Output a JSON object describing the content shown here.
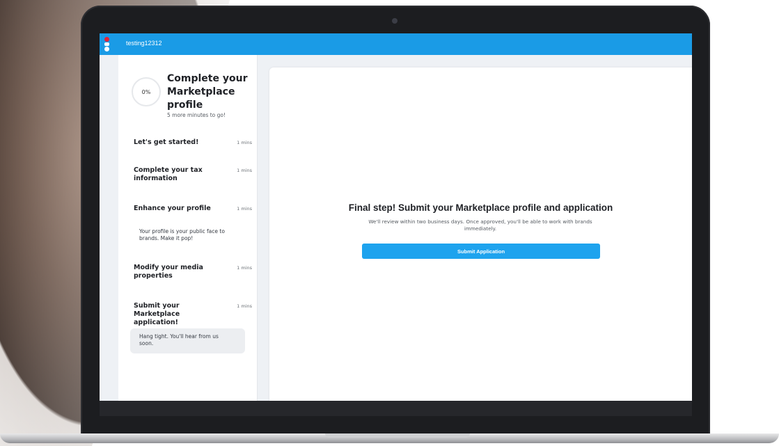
{
  "header": {
    "username": "testing12312"
  },
  "sidebar": {
    "progress": "0%",
    "title": "Complete your Marketplace profile",
    "subtitle": "5 more minutes to go!",
    "steps": [
      {
        "title": "Let's get started!",
        "time": "1 mins",
        "description": ""
      },
      {
        "title": "Complete your tax information",
        "time": "1 mins",
        "description": ""
      },
      {
        "title": "Enhance your profile",
        "time": "1 mins",
        "description": "Your profile is your public face to brands. Make it pop!"
      },
      {
        "title": "Modify your media properties",
        "time": "1 mins",
        "description": ""
      },
      {
        "title": "Submit your Marketplace application!",
        "time": "1 mins",
        "description": ""
      }
    ],
    "note": "Hang tight. You'll hear from us soon."
  },
  "main": {
    "title": "Final step! Submit your Marketplace profile and application",
    "description": "We'll review within two business days. Once approved, you'll be able to work with brands immediately.",
    "submit_label": "Submit Application"
  },
  "colors": {
    "topbar": "#1a9be6",
    "submit_button": "#1ea3ee",
    "logo_red": "#e2233a"
  }
}
